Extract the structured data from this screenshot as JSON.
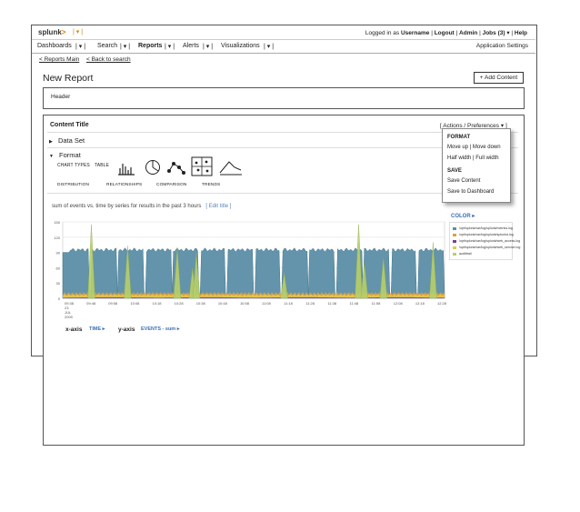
{
  "app": {
    "logo": "splunk",
    "logo_suffix": ">",
    "login_prefix": "Logged in as",
    "username": "Username",
    "logout": "Logout",
    "admin": "Admin",
    "jobs": "Jobs (3)",
    "help": "Help"
  },
  "nav": {
    "items": [
      "Dashboards",
      "Search",
      "Reports",
      "Alerts",
      "Visualizations"
    ],
    "active": "Reports",
    "app_settings": "Application Settings"
  },
  "links": {
    "reports_main": "< Reports Main",
    "back_to_search": "< Back to search"
  },
  "page": {
    "title": "New Report",
    "add_content": "+ Add Content",
    "header_label": "Header"
  },
  "panel": {
    "content_title": "Content Title",
    "actions_label": "[ Actions / Preferences",
    "actions_suffix": "]",
    "data_set": "Data Set",
    "format": "Format",
    "chart_types_label": "CHART TYPES",
    "table_label": "TABLE",
    "categories": [
      "DISTRIBUTION",
      "RELATIONSHIPS",
      "COMPARISON",
      "TRENDS"
    ]
  },
  "menu": {
    "format_heading": "FORMAT",
    "move": "Move up  |  Move down",
    "width": "Half width  |  Full width",
    "save_heading": "SAVE",
    "save_content": "Save Content",
    "save_dashboard": "Save to Dashboard"
  },
  "chart_meta": {
    "title": "sum of events vs. time by series for results in the past 3 hours",
    "edit_title": "[ Edit title ]",
    "color_label": "COLOR",
    "x_axis_label": "x-axis",
    "x_axis_value": "TIME",
    "y_axis_label": "y-axis",
    "y_axis_value": "EVENTS - sum",
    "date_lines": [
      "23",
      "JUL",
      "2009"
    ]
  },
  "colors": {
    "accent_blue": "#3a6fb5",
    "series": [
      "#5b8fa8",
      "#e0a040",
      "#7b3f8f",
      "#e8c84a",
      "#b8cf6a"
    ]
  },
  "chart_data": {
    "type": "area",
    "stacked": false,
    "ylim": [
      0,
      150
    ],
    "yticks": [
      "150",
      "120",
      "90",
      "60",
      "30",
      "0"
    ],
    "xticks": [
      "09:38",
      "09:48",
      "09:58",
      "10:08",
      "10:18",
      "10:28",
      "10:38",
      "10:48",
      "10:58",
      "11:08",
      "11:18",
      "11:28",
      "11:38",
      "11:48",
      "11:58",
      "12:08",
      "12:18",
      "12:28"
    ],
    "grid": true,
    "legend_position": "right",
    "series": [
      {
        "name": "/opt/splunk/var/log/splunk/metrics.log",
        "color": "#5b8fa8",
        "base": 95,
        "segments": 14,
        "dip": 5
      },
      {
        "name": "/opt/splunk/var/log/splunk/splunkd.log",
        "color": "#e0a040",
        "base": 6
      },
      {
        "name": "/opt/splunk/var/log/splunk/web_access.log",
        "color": "#7b3f8f",
        "base": 1
      },
      {
        "name": "/opt/splunk/var/log/splunk/web_service.log",
        "color": "#e8c84a",
        "base": 4
      },
      {
        "name": "audittrail",
        "color": "#b8cf6a",
        "peaks": [
          [
            0.075,
            145
          ],
          [
            0.17,
            103
          ],
          [
            0.3,
            100
          ],
          [
            0.34,
            60
          ],
          [
            0.58,
            50
          ],
          [
            0.775,
            145
          ],
          [
            0.84,
            80
          ],
          [
            0.97,
            110
          ],
          [
            0.35,
            90
          ],
          [
            0.79,
            70
          ]
        ]
      }
    ]
  }
}
